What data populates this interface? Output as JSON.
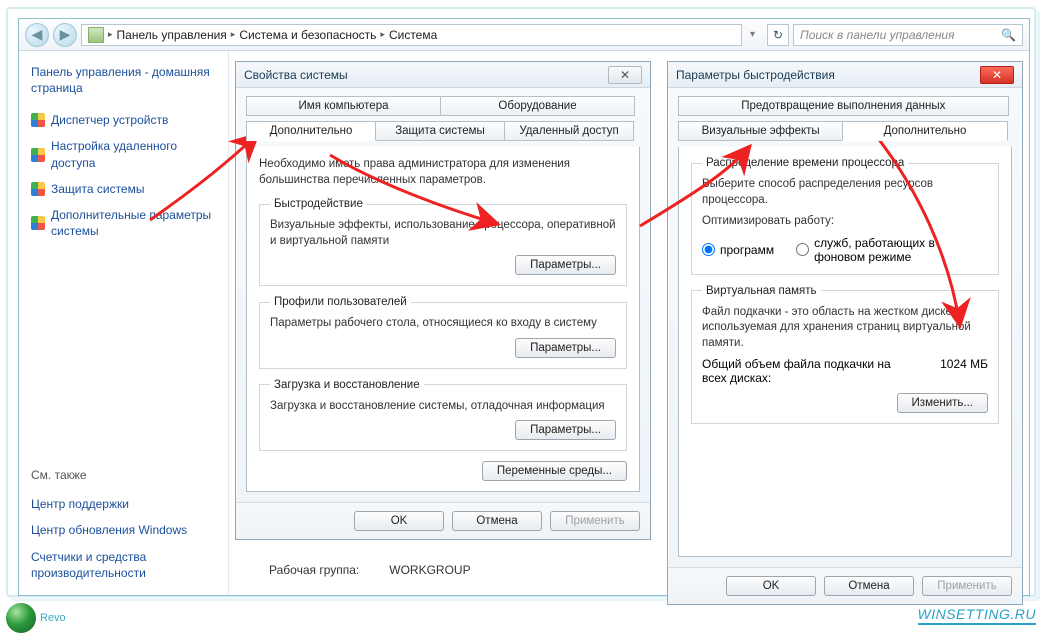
{
  "breadcrumb": {
    "root": "Панель управления",
    "b": "Система и безопасность",
    "c": "Система"
  },
  "search": {
    "placeholder": "Поиск в панели управления"
  },
  "sidebar": {
    "home": "Панель управления - домашняя страница",
    "items": [
      "Диспетчер устройств",
      "Настройка удаленного доступа",
      "Защита системы",
      "Дополнительные параметры системы"
    ],
    "see_also": "См. также",
    "extra": [
      "Центр поддержки",
      "Центр обновления Windows",
      "Счетчики и средства производительности"
    ]
  },
  "sysprops": {
    "title": "Свойства системы",
    "tabs_top": [
      "Имя компьютера",
      "Оборудование"
    ],
    "tabs_bottom": [
      "Дополнительно",
      "Защита системы",
      "Удаленный доступ"
    ],
    "admin_note": "Необходимо иметь права администратора для изменения большинства перечисленных параметров.",
    "groups": {
      "perf": {
        "legend": "Быстродействие",
        "desc": "Визуальные эффекты, использование процессора, оперативной и виртуальной памяти",
        "btn": "Параметры..."
      },
      "profiles": {
        "legend": "Профили пользователей",
        "desc": "Параметры рабочего стола, относящиеся ко входу в систему",
        "btn": "Параметры..."
      },
      "startup": {
        "legend": "Загрузка и восстановление",
        "desc": "Загрузка и восстановление системы, отладочная информация",
        "btn": "Параметры..."
      }
    },
    "env_btn": "Переменные среды...",
    "ok": "OK",
    "cancel": "Отмена",
    "apply": "Применить"
  },
  "perfopts": {
    "title": "Параметры быстродействия",
    "tabs_top": [
      "Предотвращение выполнения данных"
    ],
    "tabs_bottom": [
      "Визуальные эффекты",
      "Дополнительно"
    ],
    "cpu": {
      "legend": "Распределение времени процессора",
      "desc": "Выберите способ распределения ресурсов процессора.",
      "opt_label": "Оптимизировать работу:",
      "r1": "программ",
      "r2": "служб, работающих в фоновом режиме"
    },
    "vmem": {
      "legend": "Виртуальная память",
      "desc": "Файл подкачки - это область на жестком диске, используемая для хранения страниц виртуальной памяти.",
      "total_label": "Общий объем файла подкачки на всех дисках:",
      "total_value": "1024 МБ",
      "btn": "Изменить..."
    },
    "ok": "OK",
    "cancel": "Отмена",
    "apply": "Применить"
  },
  "info": {
    "workgroup_label": "Рабочая группа:",
    "workgroup_value": "WORKGROUP"
  },
  "footer": {
    "revo": "Revo",
    "watermark": "WINSETTING.RU"
  }
}
